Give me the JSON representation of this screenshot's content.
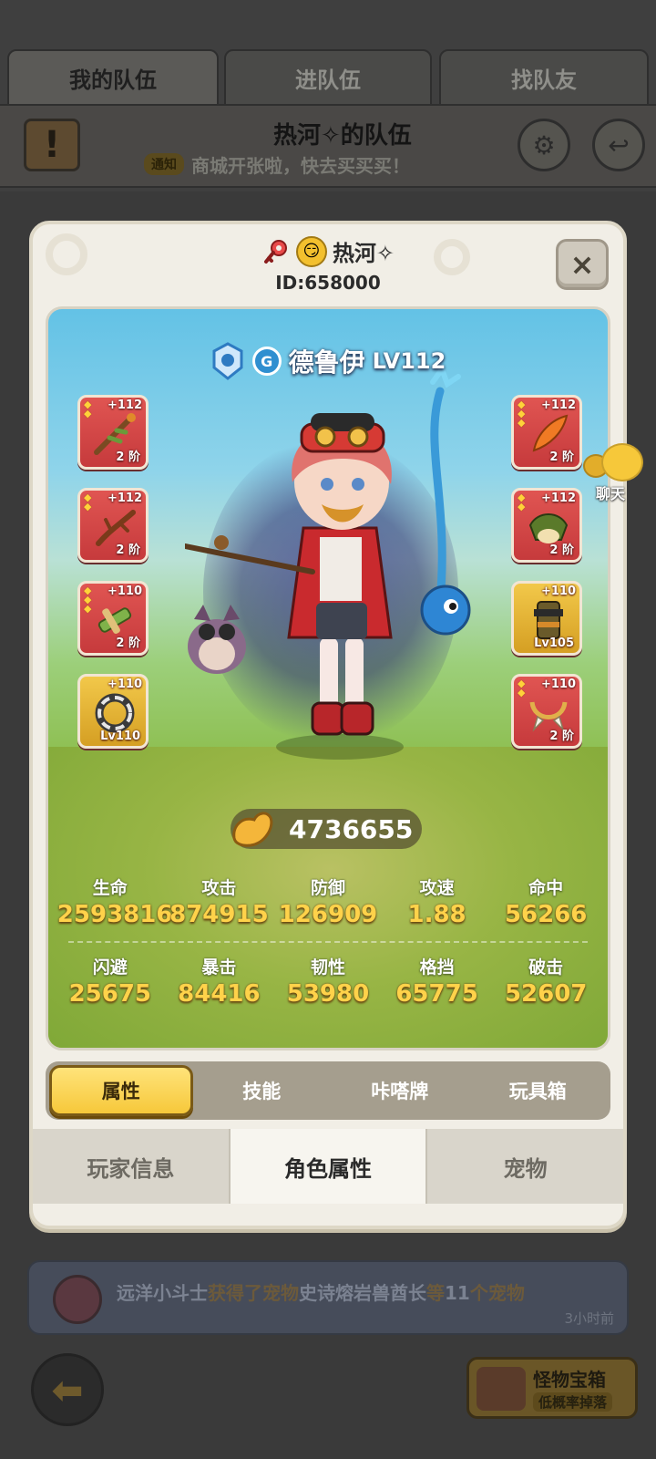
{
  "background": {
    "tabs": [
      {
        "label": "我的队伍",
        "active": true
      },
      {
        "label": "进队伍",
        "active": false
      },
      {
        "label": "找队友",
        "active": false
      }
    ],
    "team_title": "热河✧的队伍",
    "ticker_tag": "通知",
    "ticker_text": "商城开张啦，快去买买买！",
    "feed_card": {
      "player": "远洋小斗士",
      "text_1": "获得了宠物",
      "pet": "史诗熔岩兽酋长",
      "text_2": "等",
      "count": "11",
      "text_3": "个宠物",
      "time": "3小时前"
    },
    "chest": {
      "title": "怪物宝箱",
      "subtitle": "低概率掉落"
    }
  },
  "modal": {
    "player_name": "热河✧",
    "player_id": "ID:658000",
    "close_label": "×",
    "character": {
      "name": "德鲁伊",
      "level": "LV112"
    },
    "equipment_left": [
      {
        "plus": "+112",
        "tier": "2 阶",
        "color": "red",
        "stars": 2
      },
      {
        "plus": "+112",
        "tier": "2 阶",
        "color": "red",
        "stars": 2
      },
      {
        "plus": "+110",
        "tier": "2 阶",
        "color": "red",
        "stars": 3
      },
      {
        "plus": "+110",
        "tier": "Lv110",
        "color": "gold",
        "stars": 0
      }
    ],
    "equipment_right": [
      {
        "plus": "+112",
        "tier": "2 阶",
        "color": "red",
        "stars": 3
      },
      {
        "plus": "+112",
        "tier": "2 阶",
        "color": "red",
        "stars": 2
      },
      {
        "plus": "+110",
        "tier": "Lv105",
        "color": "gold",
        "stars": 0
      },
      {
        "plus": "+110",
        "tier": "2 阶",
        "color": "red",
        "stars": 2
      }
    ],
    "power": "4736655",
    "stats_row1": [
      {
        "label": "生命",
        "value": "2593816"
      },
      {
        "label": "攻击",
        "value": "874915"
      },
      {
        "label": "防御",
        "value": "126909"
      },
      {
        "label": "攻速",
        "value": "1.88"
      },
      {
        "label": "命中",
        "value": "56266"
      }
    ],
    "stats_row2": [
      {
        "label": "闪避",
        "value": "25675"
      },
      {
        "label": "暴击",
        "value": "84416"
      },
      {
        "label": "韧性",
        "value": "53980"
      },
      {
        "label": "格挡",
        "value": "65775"
      },
      {
        "label": "破击",
        "value": "52607"
      }
    ],
    "subtabs": [
      {
        "label": "属性",
        "active": true
      },
      {
        "label": "技能",
        "active": false
      },
      {
        "label": "咔嗒牌",
        "active": false
      },
      {
        "label": "玩具箱",
        "active": false
      }
    ],
    "bottom_tabs": [
      {
        "label": "玩家信息",
        "active": false
      },
      {
        "label": "角色属性",
        "active": true
      },
      {
        "label": "宠物",
        "active": false
      }
    ]
  },
  "chat": {
    "label": "聊天"
  },
  "colors": {
    "accent": "#f6c83a",
    "slot_red": "#d24846",
    "slot_gold": "#e4b232",
    "stat_value": "#ffd24a"
  }
}
